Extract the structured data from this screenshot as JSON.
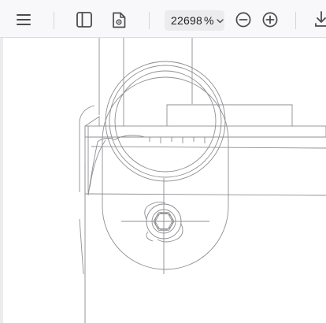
{
  "toolbar": {
    "menu_icon": "hamburger-menu-icon",
    "sidebar_icon": "sidebar-toggle-icon",
    "page_settings_icon": "document-settings-icon",
    "zoom": {
      "value": "22698",
      "unit": "%",
      "dropdown_icon": "chevron-down-icon"
    },
    "zoom_out_icon": "zoom-out-icon",
    "zoom_in_icon": "zoom-in-icon",
    "download_icon": "download-icon"
  },
  "document": {
    "content": "zoomed-in-technical-drawing"
  },
  "colors": {
    "toolbar_bg": "#f8f8fa",
    "icon": "#4a4a4f",
    "drawing_line": "#8a8a8e",
    "canvas_bg": "#ffffff"
  }
}
